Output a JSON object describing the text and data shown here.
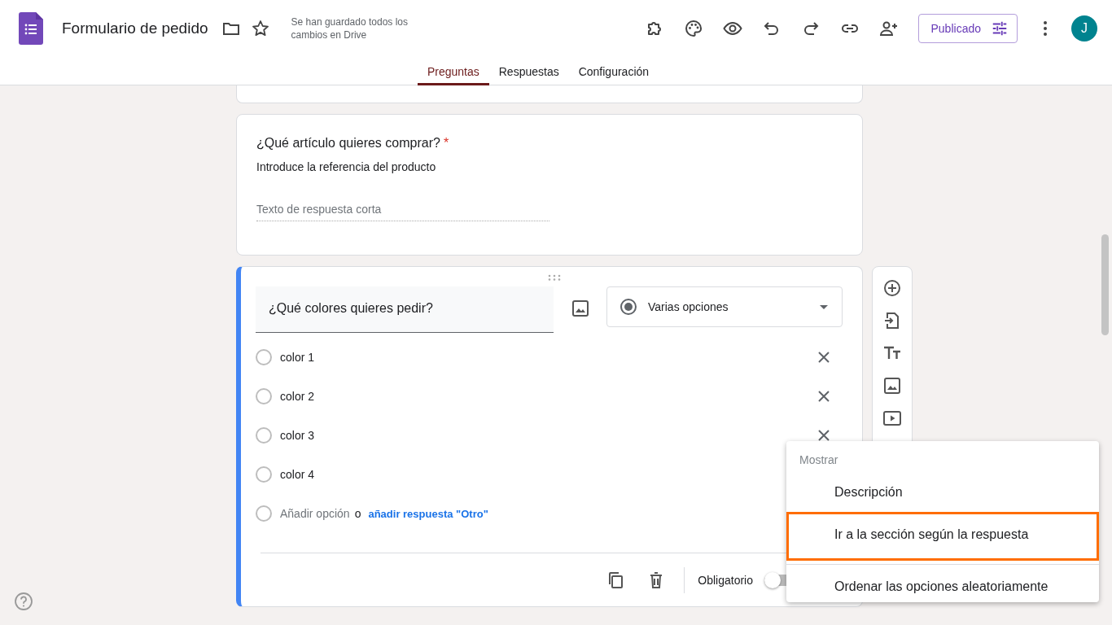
{
  "header": {
    "title": "Formulario de pedido",
    "save_status": "Se han guardado todos los cambios en Drive",
    "publish_button": "Publicado",
    "avatar": "J"
  },
  "tabs": [
    {
      "label": "Preguntas",
      "selected": true
    },
    {
      "label": "Respuestas",
      "selected": false
    },
    {
      "label": "Configuración",
      "selected": false
    }
  ],
  "question_1": {
    "title": "¿Qué artículo quieres comprar?",
    "required": true,
    "required_mark": "*",
    "description": "Introduce la referencia del producto",
    "placeholder": "Texto de respuesta corta"
  },
  "question_2": {
    "title": "¿Qué colores quieres pedir?",
    "type": "Varias opciones",
    "options": [
      {
        "label": "color 1",
        "selected": false
      },
      {
        "label": "color 2",
        "selected": false
      },
      {
        "label": "color 3",
        "selected": false
      },
      {
        "label": "color 4",
        "selected": false
      }
    ],
    "add_option": "Añadir opción",
    "or": "o",
    "add_other": "añadir respuesta \"Otro\"",
    "required_label": "Obligatorio",
    "required": false
  },
  "menu": {
    "heading": "Mostrar",
    "items": [
      {
        "label": "Descripción",
        "highlighted": false
      },
      {
        "label": "Ir a la sección según la respuesta",
        "highlighted": true
      },
      {
        "label": "Ordenar las opciones aleatoriamente",
        "highlighted": false
      }
    ]
  }
}
